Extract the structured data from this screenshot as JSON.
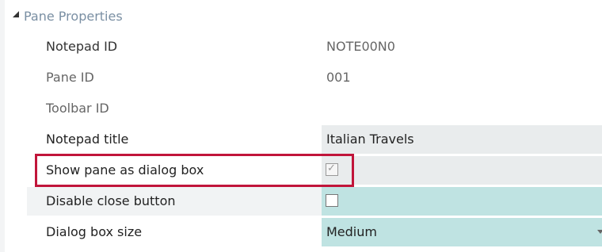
{
  "section": {
    "title": "Pane Properties",
    "icon": "collapse-triangle-icon"
  },
  "rows": {
    "notepad_id": {
      "label": "Notepad ID",
      "value": "NOTE00N0"
    },
    "pane_id": {
      "label": "Pane ID",
      "value": "001"
    },
    "toolbar_id": {
      "label": "Toolbar ID",
      "value": ""
    },
    "notepad_title": {
      "label": "Notepad title",
      "value": "Italian Travels"
    },
    "show_dialog": {
      "label": "Show pane as dialog box",
      "checked": true
    },
    "disable_close": {
      "label": "Disable close button",
      "checked": false
    },
    "dialog_size": {
      "label": "Dialog box size",
      "value": "Medium"
    }
  },
  "colors": {
    "highlight": "#c1153a",
    "editable_bg": "#e9eced",
    "teal_bg": "#bfe3e2",
    "header_text": "#7a8fa3"
  }
}
